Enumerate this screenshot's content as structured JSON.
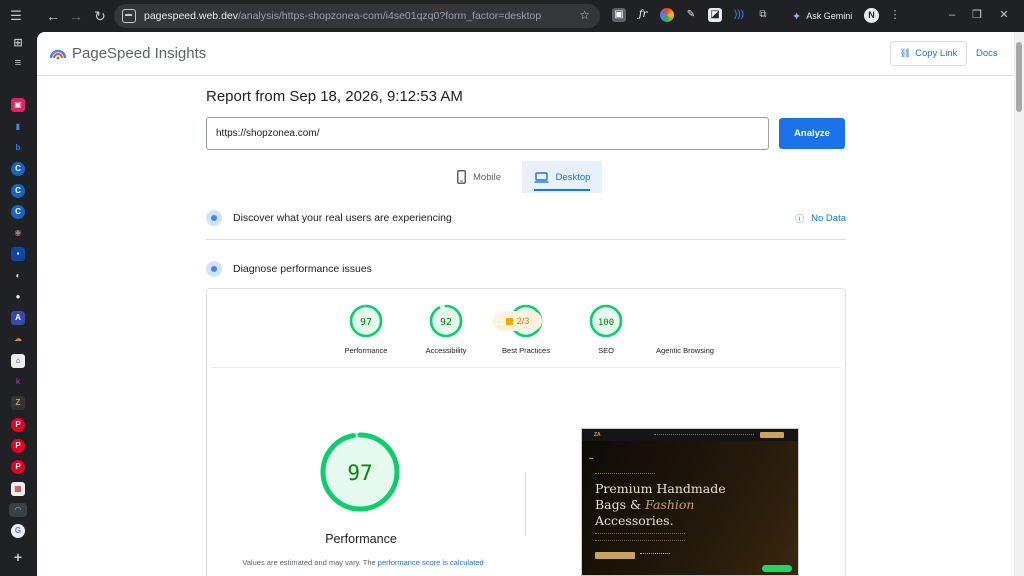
{
  "browser": {
    "url_host": "pagespeed.web.dev",
    "url_path": "/analysis/https-shopzonea-com/i4se01qzq0?form_factor=desktop",
    "ask_gemini": "Ask Gemini",
    "profile_initial": "N"
  },
  "header": {
    "title": "PageSpeed Insights",
    "copy_link": "Copy Link",
    "docs": "Docs"
  },
  "report": {
    "title": "Report from Sep 18, 2026, 9:12:53 AM",
    "url_value": "https://shopzonea.com/",
    "analyze": "Analyze"
  },
  "tabs": {
    "mobile": "Mobile",
    "desktop": "Desktop"
  },
  "sections": {
    "real_users": "Discover what your real users are experiencing",
    "no_data": "No Data",
    "diagnose": "Diagnose performance issues"
  },
  "scores": [
    {
      "value": "97",
      "label": "Performance",
      "fraction": 0.97
    },
    {
      "value": "92",
      "label": "Accessibility",
      "fraction": 0.92
    },
    {
      "value": "100",
      "label": "Best Practices",
      "fraction": 1.0
    },
    {
      "value": "100",
      "label": "SEO",
      "fraction": 1.0
    }
  ],
  "agentic": {
    "value": "2/3",
    "label": "Agentic Browsing"
  },
  "performance": {
    "score": "97",
    "fraction": 0.97,
    "label": "Performance",
    "note_prefix": "Values are estimated and may vary. The ",
    "note_link": "performance score is calculated"
  },
  "preview": {
    "heading_line1": "Premium Handmade",
    "heading_line2a": "Bags & ",
    "heading_line2b": "Fashion",
    "heading_line3": "Accessories."
  },
  "colors": {
    "pass_green": "#0cce6b",
    "pass_bg": "#e6f9ee",
    "accent_blue": "#1a73e8",
    "average_orange": "#ffa400"
  }
}
